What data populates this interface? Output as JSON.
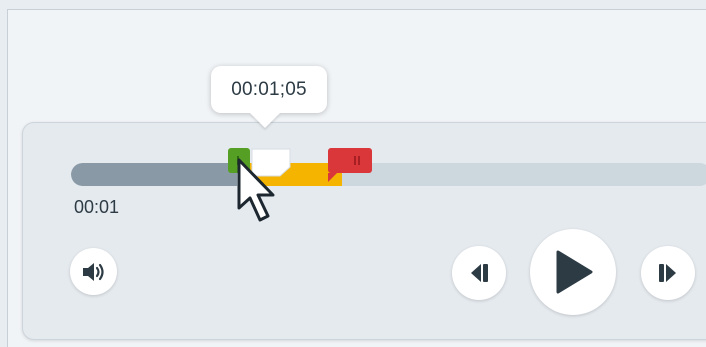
{
  "player": {
    "tooltip_time": "00:01;05",
    "current_time": "00:01",
    "progress": {
      "played_fraction": 0.26,
      "selection_start_fraction": 0.27,
      "selection_end_fraction": 0.42
    },
    "buttons": {
      "volume_icon": "volume-icon",
      "previous_icon": "step-back-icon",
      "play_icon": "play-icon",
      "next_icon": "step-forward-icon"
    }
  },
  "colors": {
    "played": "#8a99a6",
    "track": "#cdd7de",
    "selection": "#f4b400",
    "start_handle": "#55a024",
    "end_handle": "#d9373a",
    "icon": "#2d3b45"
  }
}
